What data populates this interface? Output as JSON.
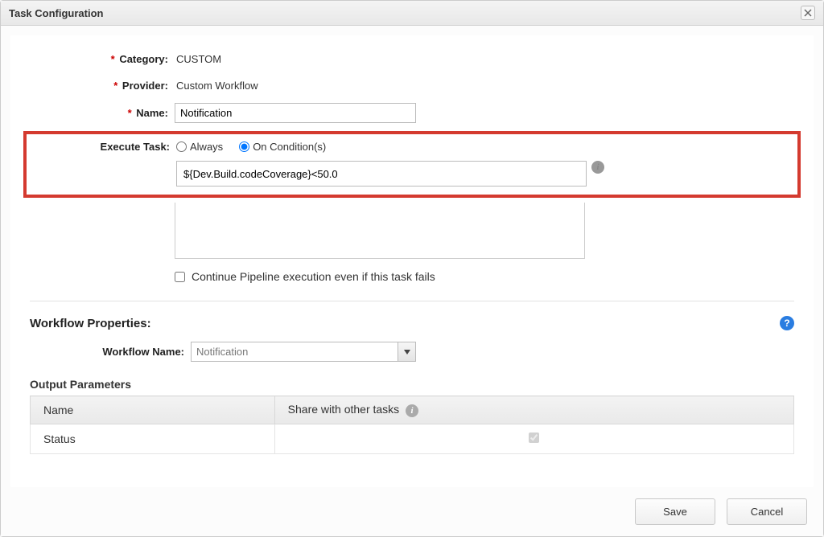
{
  "dialog": {
    "title": "Task Configuration"
  },
  "form": {
    "category_label": "Category:",
    "category_value": "CUSTOM",
    "provider_label": "Provider:",
    "provider_value": "Custom Workflow",
    "name_label": "Name:",
    "name_value": "Notification",
    "execute_label": "Execute Task:",
    "option_always": "Always",
    "option_cond": "On Condition(s)",
    "execute_selected": "cond",
    "condition_value": "${Dev.Build.codeCoverage}<50.0",
    "continue_label": "Continue Pipeline execution even if this task fails",
    "continue_checked": false
  },
  "workflow": {
    "section_title": "Workflow Properties:",
    "name_label": "Workflow Name:",
    "name_value": "Notification",
    "output_title": "Output Parameters",
    "table": {
      "headers": {
        "name": "Name",
        "share": "Share with other tasks"
      },
      "rows": [
        {
          "name": "Status",
          "shared": true
        }
      ]
    }
  },
  "footer": {
    "save": "Save",
    "cancel": "Cancel"
  },
  "icons": {
    "info": "i",
    "help": "?"
  }
}
